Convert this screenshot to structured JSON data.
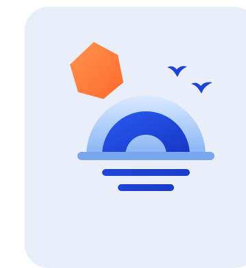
{
  "card": {
    "background": "#eaeef8"
  },
  "illustration": {
    "icon": "sunset-over-water-icon",
    "colors": {
      "hexagon": "#ff7733",
      "hexagon_light": "#ff9a5c",
      "sun_core": "#1d44d6",
      "sun_glow_top": "#d6e8ff",
      "sun_glow_bottom": "#8fbcf7",
      "horizon": "#7aa6ee",
      "water_lines": "#1d44d6",
      "birds": "#1d44d6"
    }
  }
}
